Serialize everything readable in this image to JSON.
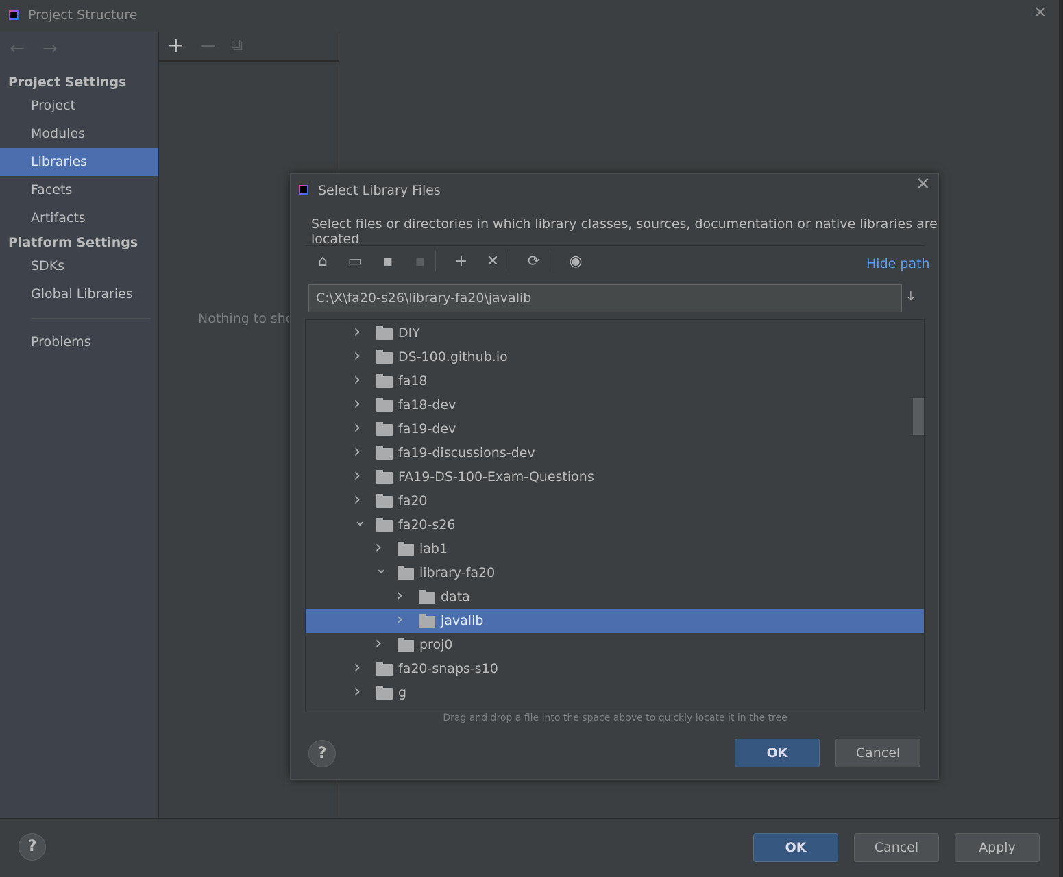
{
  "window": {
    "title": "Project Structure",
    "close": "✕"
  },
  "nav": {
    "back": "←",
    "forward": "→"
  },
  "sidebar": {
    "project_settings": "Project Settings",
    "items": [
      {
        "label": "Project"
      },
      {
        "label": "Modules"
      },
      {
        "label": "Libraries",
        "selected": true
      },
      {
        "label": "Facets"
      },
      {
        "label": "Artifacts"
      }
    ],
    "platform_settings": "Platform Settings",
    "platform_items": [
      {
        "label": "SDKs"
      },
      {
        "label": "Global Libraries"
      }
    ],
    "problems": "Problems"
  },
  "middle": {
    "add": "+",
    "remove": "−",
    "copy": "⧉",
    "empty": "Nothing to show"
  },
  "bottom": {
    "help": "?",
    "ok": "OK",
    "cancel": "Cancel",
    "apply": "Apply"
  },
  "dialog": {
    "title": "Select Library Files",
    "close": "✕",
    "description": "Select files or directories in which library classes, sources, documentation or native libraries are located",
    "toolbar": {
      "home": "⌂",
      "desktop": "▭",
      "project": "▪",
      "module": "▪",
      "new_folder": "+",
      "delete": "✕",
      "refresh": "⟳",
      "show_hidden": "◉"
    },
    "hide_path": "Hide path",
    "path": "C:\\X\\fa20-s26\\library-fa20\\javalib",
    "download": "⤓",
    "tree": [
      {
        "label": "DIY",
        "level": 0,
        "expanded": false
      },
      {
        "label": "DS-100.github.io",
        "level": 0,
        "expanded": false
      },
      {
        "label": "fa18",
        "level": 0,
        "expanded": false
      },
      {
        "label": "fa18-dev",
        "level": 0,
        "expanded": false
      },
      {
        "label": "fa19-dev",
        "level": 0,
        "expanded": false
      },
      {
        "label": "fa19-discussions-dev",
        "level": 0,
        "expanded": false
      },
      {
        "label": "FA19-DS-100-Exam-Questions",
        "level": 0,
        "expanded": false
      },
      {
        "label": "fa20",
        "level": 0,
        "expanded": false
      },
      {
        "label": "fa20-s26",
        "level": 0,
        "expanded": true
      },
      {
        "label": "lab1",
        "level": 1,
        "expanded": false
      },
      {
        "label": "library-fa20",
        "level": 1,
        "expanded": true
      },
      {
        "label": "data",
        "level": 2,
        "expanded": false
      },
      {
        "label": "javalib",
        "level": 2,
        "expanded": false,
        "selected": true
      },
      {
        "label": "proj0",
        "level": 1,
        "expanded": false
      },
      {
        "label": "fa20-snaps-s10",
        "level": 0,
        "expanded": false
      },
      {
        "label": "g",
        "level": 0,
        "expanded": false
      }
    ],
    "hint": "Drag and drop a file into the space above to quickly locate it in the tree",
    "help": "?",
    "ok": "OK",
    "cancel": "Cancel"
  },
  "colors": {
    "accent": "#4b6eaf",
    "link": "#589df6",
    "default_button": "#365880"
  }
}
